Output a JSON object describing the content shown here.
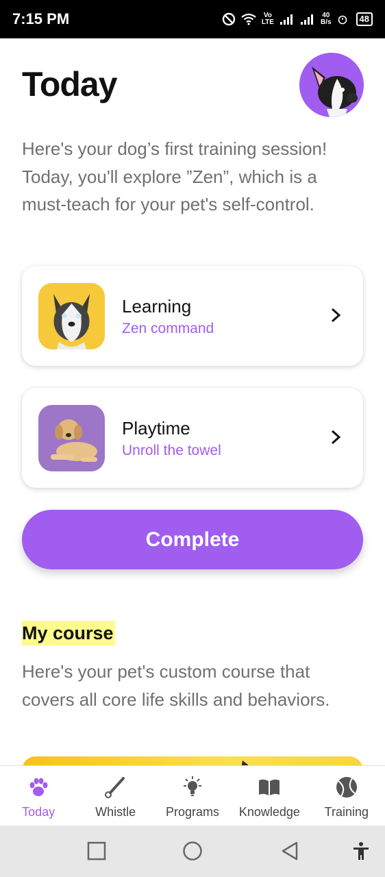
{
  "status_bar": {
    "time": "7:15 PM",
    "network_top": "Vo",
    "network_bottom": "LTE",
    "speed_top": "40",
    "speed_bottom": "B/s",
    "battery": "48"
  },
  "header": {
    "title": "Today",
    "intro": "Here's your dog’s first training session! Today, you'll explore ”Zen”, which is a must-teach for your pet's self-control."
  },
  "sessions": [
    {
      "title": "Learning",
      "subtitle": "Zen command",
      "thumb_color": "#f6c93a"
    },
    {
      "title": "Playtime",
      "subtitle": "Unroll the towel",
      "thumb_color": "#9d76c7"
    }
  ],
  "complete_label": "Complete",
  "course": {
    "title": "My course",
    "description": "Here's your pet's custom course that covers all core life skills and behaviors."
  },
  "bottom_nav": [
    {
      "label": "Today",
      "icon": "paw-icon",
      "active": true
    },
    {
      "label": "Whistle",
      "icon": "whistle-icon",
      "active": false
    },
    {
      "label": "Programs",
      "icon": "lightbulb-icon",
      "active": false
    },
    {
      "label": "Knowledge",
      "icon": "book-icon",
      "active": false
    },
    {
      "label": "Training",
      "icon": "ball-icon",
      "active": false
    }
  ],
  "colors": {
    "accent": "#a15cf0",
    "highlight": "#fdfb8c",
    "muted_text": "#707070"
  }
}
